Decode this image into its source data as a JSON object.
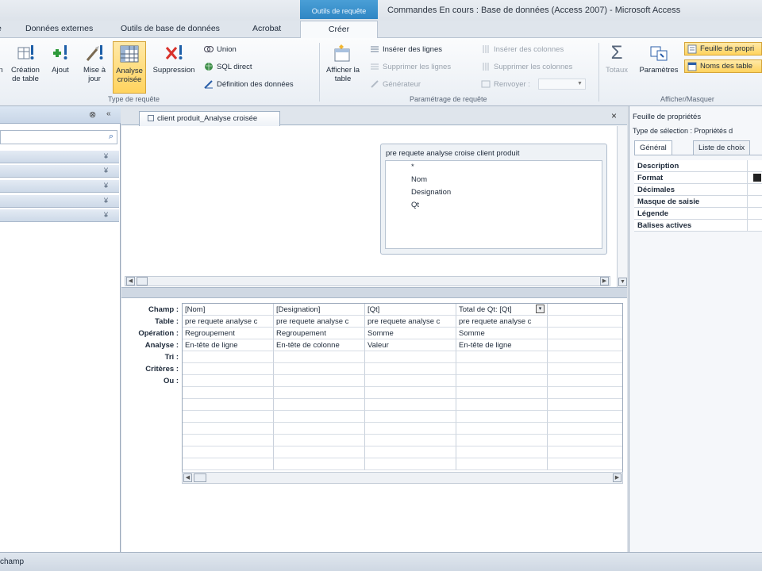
{
  "title_bar": {
    "context_tab": "Outils de requête",
    "window_title": "Commandes En cours : Base de données (Access 2007) - Microsoft Access"
  },
  "ribbon_tabs": [
    {
      "label": "e"
    },
    {
      "label": "Données externes"
    },
    {
      "label": "Outils de base de données"
    },
    {
      "label": "Acrobat"
    },
    {
      "label": "Créer"
    }
  ],
  "ribbon": {
    "query_type": {
      "label": "Type de requête",
      "buttons": [
        {
          "label": "n",
          "icon": "run-icon"
        },
        {
          "label": "Création de table",
          "icon": "make-table-icon"
        },
        {
          "label": "Ajout",
          "icon": "append-icon"
        },
        {
          "label": "Mise à jour",
          "icon": "update-icon"
        },
        {
          "label": "Analyse croisée",
          "icon": "crosstab-icon",
          "active": true
        },
        {
          "label": "Suppression",
          "icon": "delete-icon"
        }
      ],
      "small": [
        {
          "label": "Union",
          "icon": "union-icon"
        },
        {
          "label": "SQL direct",
          "icon": "globe-icon"
        },
        {
          "label": "Définition des données",
          "icon": "data-definition-icon"
        }
      ]
    },
    "query_setup": {
      "label": "Paramétrage de requête",
      "show_table": "Afficher la table",
      "small_left": [
        {
          "label": "Insérer des lignes",
          "disabled": false
        },
        {
          "label": "Supprimer les lignes",
          "disabled": true
        },
        {
          "label": "Générateur",
          "disabled": true
        }
      ],
      "small_right": [
        {
          "label": "Insérer des colonnes",
          "disabled": true
        },
        {
          "label": "Supprimer les colonnes",
          "disabled": true
        },
        {
          "label": "Renvoyer :",
          "disabled": true
        }
      ]
    },
    "show_hide": {
      "label": "Afficher/Masquer",
      "totals": "Totaux",
      "parameters": "Paramètres",
      "property_sheet": "Feuille de propri",
      "table_names": "Noms des table"
    }
  },
  "nav_pane": {
    "sections": [
      {
        "label": ""
      },
      {
        "label": ""
      },
      {
        "label": ""
      },
      {
        "label": ""
      },
      {
        "label": ""
      }
    ]
  },
  "document": {
    "tab_label": "client produit_Analyse croisée",
    "table_box": {
      "title": "pre requete analyse croise client produit",
      "fields": [
        "*",
        "Nom",
        "Designation",
        "Qt"
      ]
    },
    "grid": {
      "row_labels": [
        "Champ :",
        "Table :",
        "Opération :",
        "Analyse :",
        "Tri :",
        "Critères :",
        "Ou :"
      ],
      "columns": [
        {
          "champ": "[Nom]",
          "table": "pre requete analyse c",
          "operation": "Regroupement",
          "analyse": "En-tête de ligne"
        },
        {
          "champ": "[Designation]",
          "table": "pre requete analyse c",
          "operation": "Regroupement",
          "analyse": "En-tête de colonne"
        },
        {
          "champ": "[Qt]",
          "table": "pre requete analyse c",
          "operation": "Somme",
          "analyse": "Valeur"
        },
        {
          "champ": "Total de Qt: [Qt]",
          "table": "pre requete analyse c",
          "operation": "Somme",
          "analyse": "En-tête de ligne"
        },
        {
          "champ": "",
          "table": "",
          "operation": "",
          "analyse": ""
        }
      ]
    }
  },
  "property_sheet": {
    "title": "Feuille de propriétés",
    "selection_type": "Type de sélection :  Propriétés d",
    "tabs": [
      "Général",
      "Liste de choix"
    ],
    "rows": [
      "Description",
      "Format",
      "Décimales",
      "Masque de saisie",
      "Légende",
      "Balises actives"
    ]
  },
  "status_bar": {
    "text": "champ"
  }
}
